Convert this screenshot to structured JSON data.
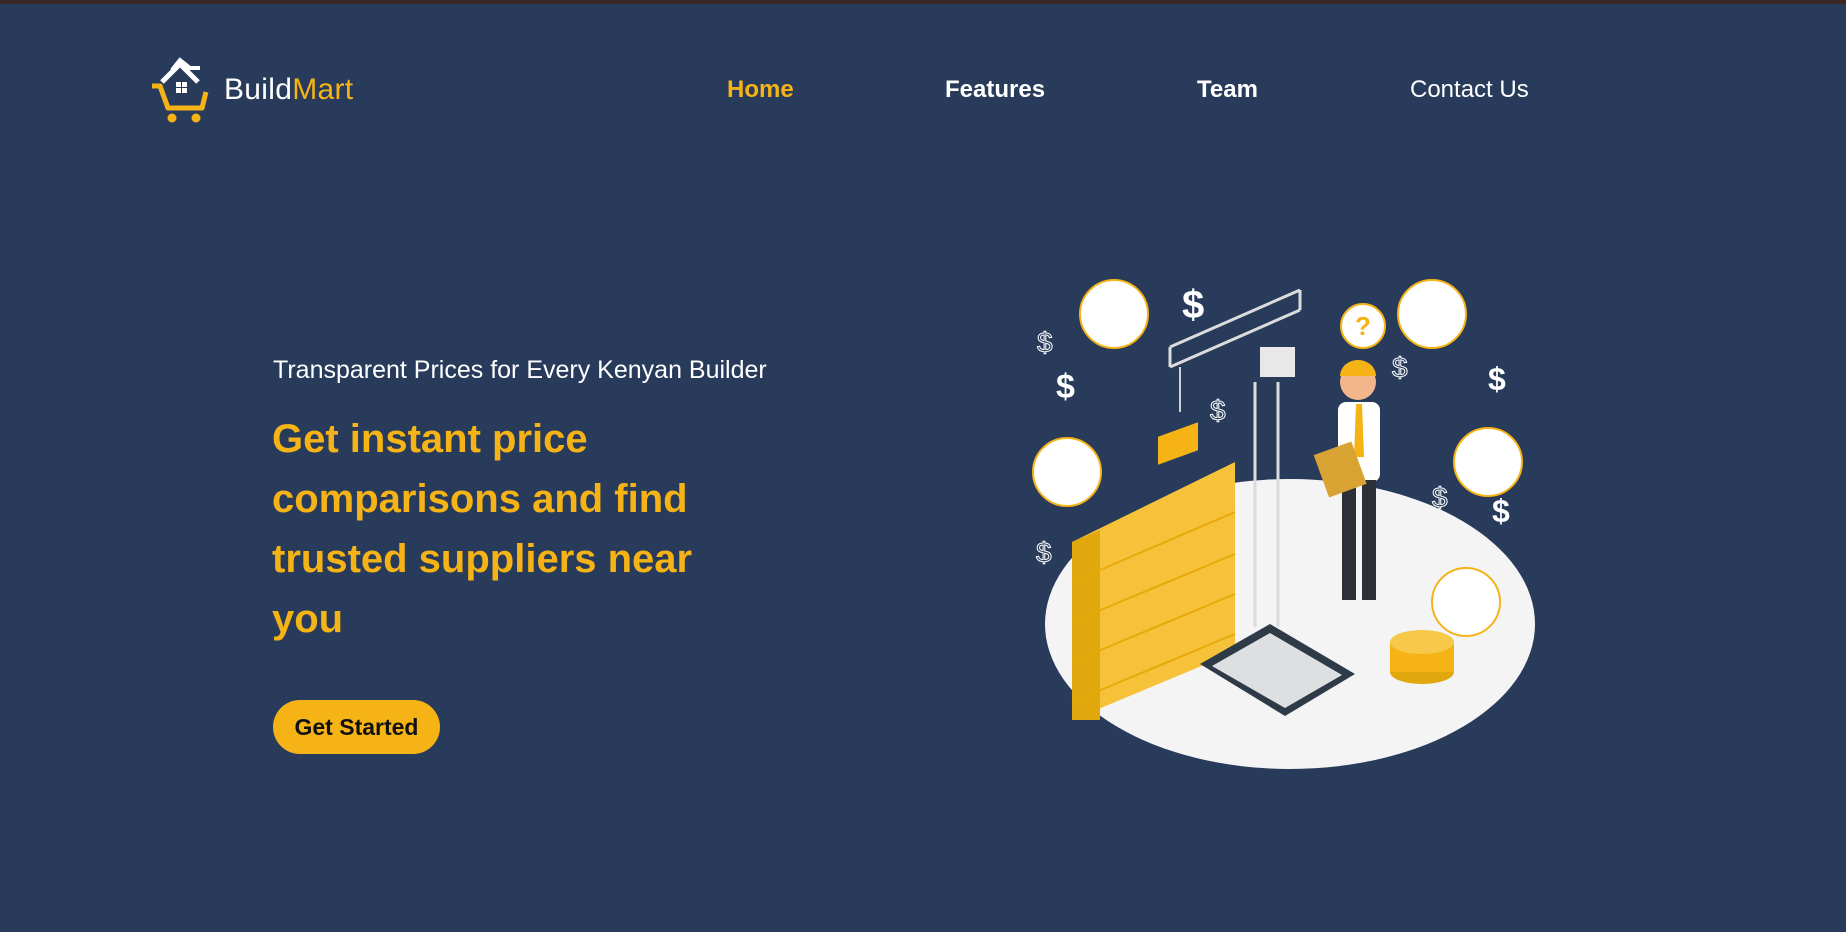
{
  "brand": {
    "name_part1": "Build",
    "name_part2": "Mart",
    "accent_color": "#f5b316",
    "background_color": "#283b5b"
  },
  "nav": {
    "items": [
      {
        "label": "Home",
        "active": true
      },
      {
        "label": "Features",
        "active": false
      },
      {
        "label": "Team",
        "active": false
      },
      {
        "label": "Contact Us",
        "active": false
      }
    ]
  },
  "hero": {
    "subtitle": "Transparent Prices for Every Kenyan Builder",
    "title": "Get instant price comparisons and find trusted suppliers near you",
    "cta_label": "Get Started"
  },
  "illustration": {
    "description_icon": "construction-pricing-illustration"
  }
}
